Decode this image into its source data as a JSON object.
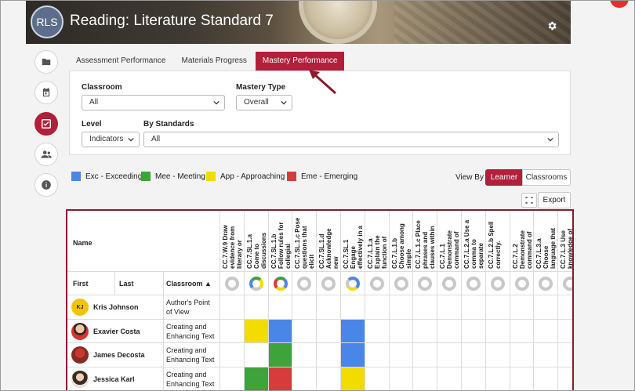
{
  "banner": {
    "avatar_text": "RLS",
    "title": "Reading: Literature Standard 7"
  },
  "sidebar": [
    {
      "icon": "folder-icon"
    },
    {
      "icon": "calendar-icon"
    },
    {
      "icon": "checkbox-icon",
      "active": true
    },
    {
      "icon": "users-icon"
    },
    {
      "icon": "info-icon"
    }
  ],
  "tabs": [
    {
      "label": "Assessment Performance"
    },
    {
      "label": "Materials Progress"
    },
    {
      "label": "Mastery Performance",
      "active": true
    }
  ],
  "filters": {
    "classroom_label": "Classroom",
    "classroom_value": "All",
    "mastery_type_label": "Mastery Type",
    "mastery_type_value": "Overall",
    "level_label": "Level",
    "level_value": "Indicators",
    "standards_label": "By Standards",
    "standards_value": "All"
  },
  "legend": [
    {
      "label": "Exc - Exceeding",
      "color": "#4a86e8"
    },
    {
      "label": "Mee - Meeting",
      "color": "#3ea33a"
    },
    {
      "label": "App - Approaching",
      "color": "#f2dc00"
    },
    {
      "label": "Eme - Emerging",
      "color": "#d83b3b"
    }
  ],
  "view_by": {
    "label": "View By",
    "learner": "Learner",
    "classrooms": "Classrooms"
  },
  "export_label": "Export",
  "table": {
    "name_header": "Name",
    "first_header": "First",
    "last_header": "Last",
    "classroom_header": "Classroom ▲",
    "standards": [
      "CC.7.W.9 Draw\nevidence from\nliterary or",
      "CC.7.SL.1.a\nCome to\ndiscussions",
      "CC.7.SL.1.b\nFollow rules for\ncollegial",
      "CC.7.SL.1.c Pose\nquestions that\nelicit",
      "CC.7.SL.1.d\nAcknowledge\nnew",
      "CC.7.SL.1\nEngage\neffectively in a",
      "CC.7.L.1.a\nExplain the\nfunction of",
      "CC.7.L.1.b\nChoose among\nsimple",
      "CC.7.L.1.c Place\nphrases and\nclauses within",
      "CC.7.L.1\nDemonstrate\ncommand of",
      "CC.7.L.2.a Use a\ncomma to\nseparate",
      "CC.7.L.2.b Spell\ncorrectly.",
      "CC.7.L.2\nDemonstrate\ncommand of",
      "CC.7.L.3.a\nChoose\nlanguage that",
      "CC.7.L.3 Use\nknowledge of"
    ],
    "students": [
      {
        "name": "Kris Johnson",
        "initials": "KJ",
        "classroom": "Author's Point\nof View",
        "cells": [
          "",
          "",
          "",
          "",
          "",
          "",
          "",
          "",
          "",
          "",
          "",
          "",
          "",
          "",
          ""
        ]
      },
      {
        "name": "Exavier Costa",
        "initials": "",
        "classroom": "Creating and\nEnhancing Text",
        "cells": [
          "",
          "#f2dc00",
          "#4a86e8",
          "",
          "",
          "#4a86e8",
          "",
          "",
          "",
          "",
          "",
          "",
          "",
          "",
          ""
        ]
      },
      {
        "name": "James Decosta",
        "initials": "",
        "classroom": "Creating and\nEnhancing Text",
        "cells": [
          "",
          "",
          "#3ea33a",
          "",
          "",
          "#4a86e8",
          "",
          "",
          "",
          "",
          "",
          "",
          "",
          "",
          ""
        ]
      },
      {
        "name": "Jessica Karl",
        "initials": "",
        "classroom": "Creating and\nEnhancing Text",
        "cells": [
          "",
          "#3ea33a",
          "#d83b3b",
          "",
          "",
          "#f2dc00",
          "",
          "",
          "",
          "",
          "",
          "",
          "",
          "",
          ""
        ]
      }
    ]
  }
}
